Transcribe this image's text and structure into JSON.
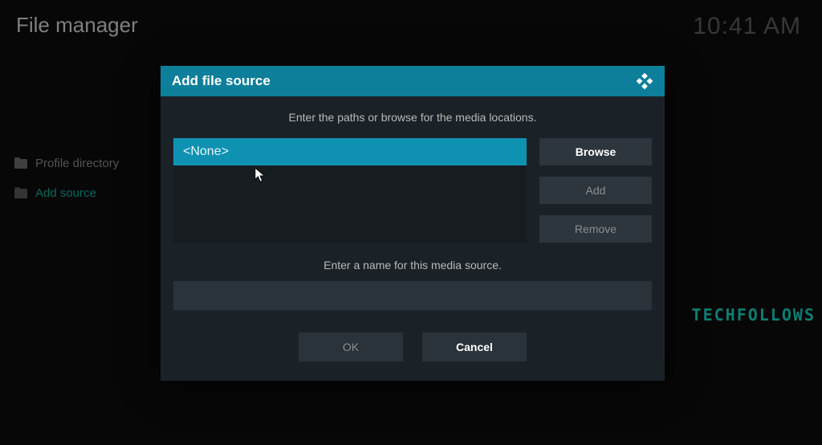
{
  "header": {
    "title": "File manager",
    "clock": "10:41 AM"
  },
  "sidebar": {
    "items": [
      {
        "label": "Profile directory"
      },
      {
        "label": "Add source"
      }
    ]
  },
  "dialog": {
    "title": "Add file source",
    "instruction": "Enter the paths or browse for the media locations.",
    "selected_path": "<None>",
    "browse_label": "Browse",
    "add_label": "Add",
    "remove_label": "Remove",
    "name_prompt": "Enter a name for this media source.",
    "name_value": "",
    "ok_label": "OK",
    "cancel_label": "Cancel"
  },
  "watermark": "TECHFOLLOWS"
}
